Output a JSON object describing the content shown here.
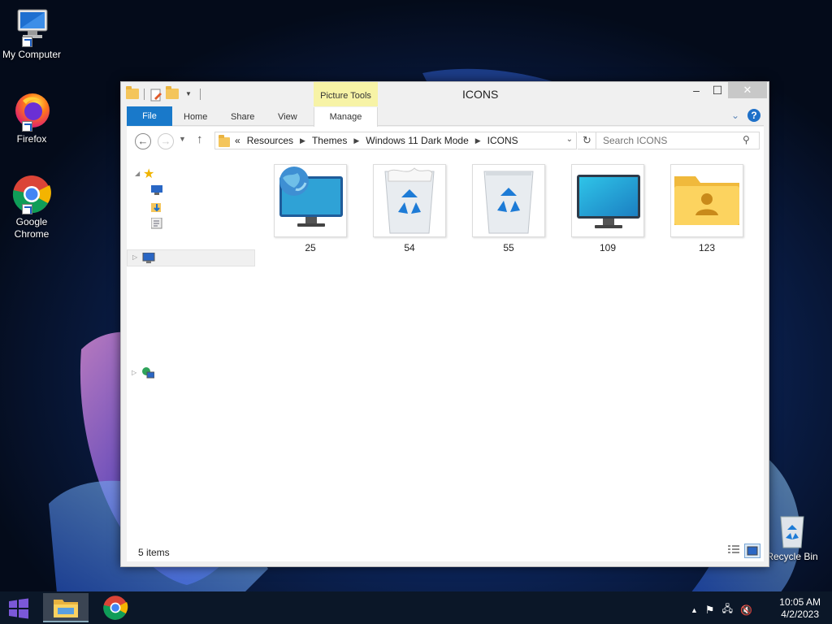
{
  "desktop": {
    "icons": [
      {
        "label": "My Computer",
        "icon": "computer-icon"
      },
      {
        "label": "Firefox",
        "icon": "firefox-icon"
      },
      {
        "label": "Google Chrome",
        "icon": "chrome-icon"
      },
      {
        "label": "Recycle Bin",
        "icon": "recycle-bin-icon"
      }
    ]
  },
  "window": {
    "title": "ICONS",
    "context_tab_group": "Picture Tools",
    "ribbon_tabs": [
      "File",
      "Home",
      "Share",
      "View",
      "Manage"
    ],
    "address": {
      "overflow": "«",
      "crumbs": [
        "Resources",
        "Themes",
        "Windows 11 Dark Mode",
        "ICONS"
      ]
    },
    "search_placeholder": "Search ICONS",
    "files": [
      {
        "name": "25",
        "icon": "monitor-globe-icon"
      },
      {
        "name": "54",
        "icon": "recycle-bin-full-icon"
      },
      {
        "name": "55",
        "icon": "recycle-bin-empty-icon"
      },
      {
        "name": "109",
        "icon": "monitor-icon"
      },
      {
        "name": "123",
        "icon": "user-folder-icon"
      }
    ],
    "status": "5 items"
  },
  "taskbar": {
    "clock_time": "10:05 AM",
    "clock_date": "4/2/2023",
    "pinned": [
      "start-icon",
      "file-explorer-icon",
      "chrome-icon"
    ]
  },
  "colors": {
    "accent": "#1979ca",
    "context_tab": "#f7f3a6",
    "taskbar": "#0b1728"
  }
}
